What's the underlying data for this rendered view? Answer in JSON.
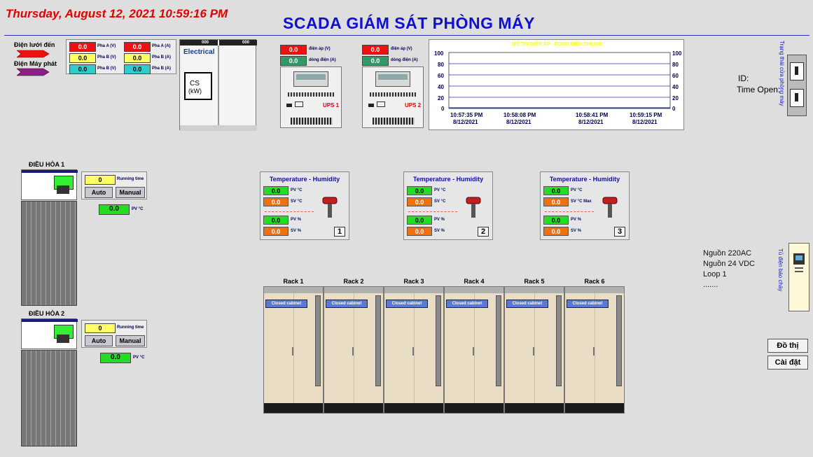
{
  "header": {
    "datetime": "Thursday, August 12, 2021 10:59:16 PM",
    "title": "SCADA GIÁM SÁT  PHÒNG MÁY"
  },
  "power": {
    "grid_label": "Điện lưới đến",
    "gen_label": "Điện Máy phát",
    "rows": [
      {
        "v": "0.0",
        "v_tag": "Pha A (V)",
        "a": "0.0",
        "a_tag": "Pha A (A)"
      },
      {
        "v": "0.0",
        "v_tag": "Pha B (V)",
        "a": "0.0",
        "a_tag": "Pha B (A)"
      },
      {
        "v": "0.0",
        "v_tag": "Pha B (V)",
        "a": "0.0",
        "a_tag": "Pha B (A)"
      }
    ],
    "electrical_label": "Electrical",
    "cs_label": "CS",
    "kw_label": "(kW)",
    "cab_val": "000"
  },
  "ups": [
    {
      "voltage": "0.0",
      "v_tag": "điện áp (V)",
      "current": "0.0",
      "c_tag": "dòng điện (A)",
      "name": "UPS 1"
    },
    {
      "voltage": "0.0",
      "v_tag": "điện áp (V)",
      "current": "0.0",
      "c_tag": "dòng điện (A)",
      "name": "UPS 2"
    }
  ],
  "trend": {
    "title": "ĐỒ THỊ ĐIỆN ÁP - DÒNG ĐIỆN ONLINE",
    "y_ticks": [
      "100",
      "80",
      "60",
      "40",
      "20",
      "0"
    ],
    "x_ticks": [
      {
        "time": "10:57:35 PM",
        "date": "8/12/2021"
      },
      {
        "time": "10:58:08 PM",
        "date": "8/12/2021"
      },
      {
        "time": "10:58:41 PM",
        "date": "8/12/2021"
      },
      {
        "time": "10:59:15 PM",
        "date": "8/12/2021"
      }
    ]
  },
  "door": {
    "id_label": "ID:",
    "time_open_label": "Time Open:",
    "vertical_label": "Trạng thái cửa phòng máy"
  },
  "ac": [
    {
      "title": "ĐIỀU HÒA 1",
      "running_time": "0",
      "running_label": "Running time",
      "auto": "Auto",
      "manual": "Manual",
      "pv": "0.0",
      "pv_tag": "PV °C"
    },
    {
      "title": "ĐIỀU HÒA 2",
      "running_time": "0",
      "running_label": "Running time",
      "auto": "Auto",
      "manual": "Manual",
      "pv": "0.0",
      "pv_tag": "PV °C"
    }
  ],
  "sensors": [
    {
      "title": "Temperature - Humidity",
      "pv_t": "0.0",
      "pv_t_tag": "PV °C",
      "sv_t": "0.0",
      "sv_t_tag": "SV °C",
      "pv_h": "0.0",
      "pv_h_tag": "PV %",
      "sv_h": "0.0",
      "sv_h_tag": "SV %",
      "num": "1"
    },
    {
      "title": "Temperature - Humidity",
      "pv_t": "0.0",
      "pv_t_tag": "PV °C",
      "sv_t": "0.0",
      "sv_t_tag": "SV °C",
      "pv_h": "0.0",
      "pv_h_tag": "PV %",
      "sv_h": "0.0",
      "sv_h_tag": "SV %",
      "num": "2"
    },
    {
      "title": "Temperature - Humidity",
      "pv_t": "0.0",
      "pv_t_tag": "PV °C",
      "sv_t": "0.0",
      "sv_t_tag": "SV °C Max",
      "pv_h": "0.0",
      "pv_h_tag": "PV %",
      "sv_h": "0.0",
      "sv_h_tag": "SV %",
      "num": "3"
    }
  ],
  "racks": [
    {
      "name": "Rack 1",
      "status": "Closed cabinet"
    },
    {
      "name": "Rack 2",
      "status": "Closed cabinet"
    },
    {
      "name": "Rack 3",
      "status": "Closed cabinet"
    },
    {
      "name": "Rack 4",
      "status": "Closed cabinet"
    },
    {
      "name": "Rack 5",
      "status": "Closed cabinet"
    },
    {
      "name": "Rack 6",
      "status": "Closed cabinet"
    }
  ],
  "fire": {
    "items": [
      "Nguồn 220AC",
      "Nguồn 24 VDC",
      "Loop 1",
      "......."
    ],
    "vertical_label": "Tủ điện báo cháy"
  },
  "buttons": {
    "chart": "Đồ thị",
    "settings": "Cài đặt"
  },
  "colors": {
    "title": "#1010d0",
    "alarm": "#ee1111",
    "ok": "#22dd22"
  }
}
